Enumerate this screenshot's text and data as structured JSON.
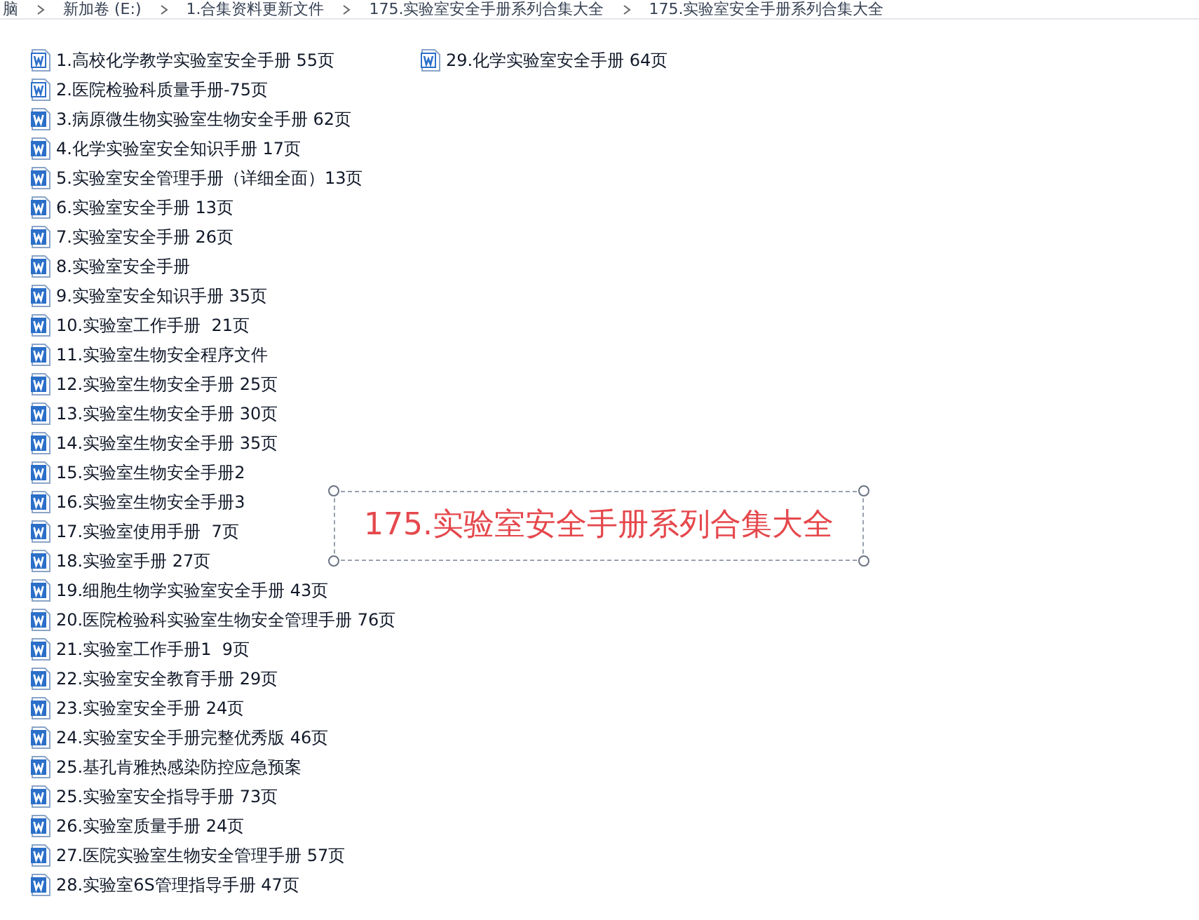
{
  "breadcrumb": [
    "脑",
    "新加卷 (E:)",
    "1.合集资料更新文件",
    "175.实验室安全手册系列合集大全",
    "175.实验室安全手册系列合集大全"
  ],
  "files": [
    {
      "name": "1.高校化学教学实验室安全手册 55页",
      "kind": "doc"
    },
    {
      "name": "2.医院检验科质量手册-75页",
      "kind": "doc"
    },
    {
      "name": "3.病原微生物实验室生物安全手册 62页",
      "kind": "docx"
    },
    {
      "name": "4.化学实验室安全知识手册 17页",
      "kind": "docx"
    },
    {
      "name": "5.实验室安全管理手册（详细全面）13页",
      "kind": "docx"
    },
    {
      "name": "6.实验室安全手册 13页",
      "kind": "docx"
    },
    {
      "name": "7.实验室安全手册 26页",
      "kind": "docx"
    },
    {
      "name": "8.实验室安全手册",
      "kind": "docx"
    },
    {
      "name": "9.实验室安全知识手册 35页",
      "kind": "docx"
    },
    {
      "name": "10.实验室工作手册  21页",
      "kind": "docx"
    },
    {
      "name": "11.实验室生物安全程序文件",
      "kind": "docx"
    },
    {
      "name": "12.实验室生物安全手册 25页",
      "kind": "docx"
    },
    {
      "name": "13.实验室生物安全手册 30页",
      "kind": "docx"
    },
    {
      "name": "14.实验室生物安全手册 35页",
      "kind": "docx"
    },
    {
      "name": "15.实验室生物安全手册2",
      "kind": "docx"
    },
    {
      "name": "16.实验室生物安全手册3",
      "kind": "docx"
    },
    {
      "name": "17.实验室使用手册  7页",
      "kind": "docx"
    },
    {
      "name": "18.实验室手册 27页",
      "kind": "docx"
    },
    {
      "name": "19.细胞生物学实验室安全手册 43页",
      "kind": "docx"
    },
    {
      "name": "20.医院检验科实验室生物安全管理手册 76页",
      "kind": "docx"
    },
    {
      "name": "21.实验室工作手册1  9页",
      "kind": "docx"
    },
    {
      "name": "22.实验室安全教育手册 29页",
      "kind": "docx"
    },
    {
      "name": "23.实验室安全手册 24页",
      "kind": "docx"
    },
    {
      "name": "24.实验室安全手册完整优秀版 46页",
      "kind": "docx"
    },
    {
      "name": "25.基孔肯雅热感染防控应急预案",
      "kind": "docx"
    },
    {
      "name": "25.实验室安全指导手册 73页",
      "kind": "docx"
    },
    {
      "name": "26.实验室质量手册 24页",
      "kind": "docx"
    },
    {
      "name": "27.医院实验室生物安全管理手册 57页",
      "kind": "docx"
    },
    {
      "name": "28.实验室6S管理指导手册 47页",
      "kind": "docx"
    },
    {
      "name": "29.化学实验室安全手册 64页",
      "kind": "doc"
    }
  ],
  "title_box": {
    "text": "175.实验室安全手册系列合集大全"
  }
}
